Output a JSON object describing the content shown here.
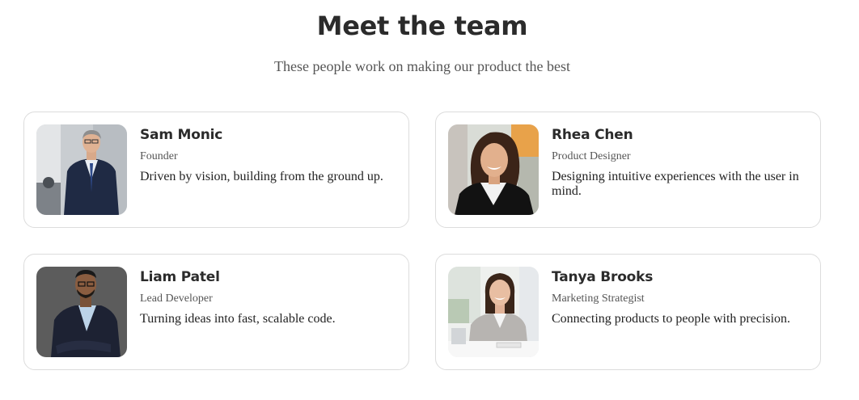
{
  "section": {
    "title": "Meet the team",
    "subtitle": "These people work on making our product the best"
  },
  "members": [
    {
      "name": "Sam Monic",
      "role": "Founder",
      "description": "Driven by vision, building from the ground up."
    },
    {
      "name": "Rhea Chen",
      "role": "Product Designer",
      "description": "Designing intuitive experiences with the user in mind."
    },
    {
      "name": "Liam Patel",
      "role": "Lead Developer",
      "description": "Turning ideas into fast, scalable code."
    },
    {
      "name": "Tanya Brooks",
      "role": "Marketing Strategist",
      "description": "Connecting products to people with precision."
    }
  ]
}
